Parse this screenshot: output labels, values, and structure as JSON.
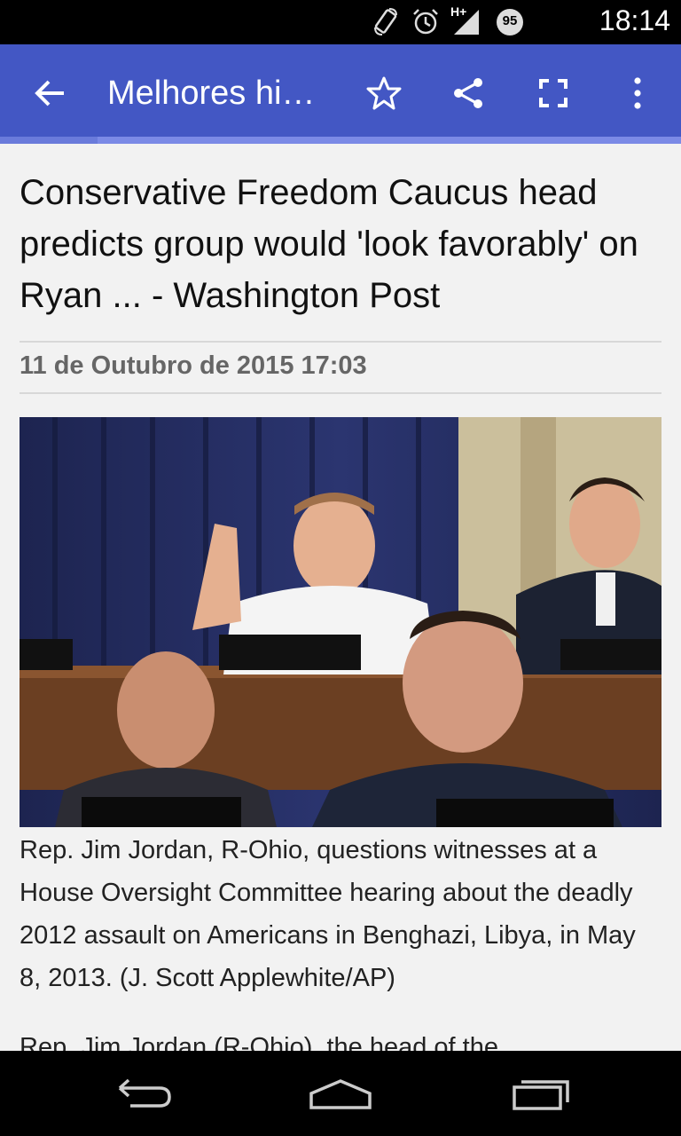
{
  "status_bar": {
    "time": "18:14",
    "battery_level": "95",
    "network_label": "H+",
    "icons": [
      "rotate-icon",
      "alarm-icon",
      "signal-icon",
      "battery-icon"
    ]
  },
  "app_bar": {
    "title": "Melhores hi…",
    "actions": [
      "back-arrow-icon",
      "star-icon",
      "share-icon",
      "fullscreen-icon",
      "overflow-menu-icon"
    ],
    "color": "#4357c4"
  },
  "article": {
    "headline": "Conservative Freedom Caucus head predicts group would 'look favorably' on Ryan ... - Washington Post",
    "date": "11 de Outubro de 2015 17:03",
    "caption": "Rep. Jim Jordan, R-Ohio, questions witnesses at a House Oversight Committee hearing about the deadly 2012 assault on Americans in Benghazi, Libya, in May 8, 2013. (J. Scott Applewhite/AP)",
    "body_start": "Rep. Jim Jordan (R-Ohio), the head of the"
  },
  "nav_bar": {
    "buttons": [
      "back-nav-icon",
      "home-nav-icon",
      "recents-nav-icon"
    ]
  }
}
